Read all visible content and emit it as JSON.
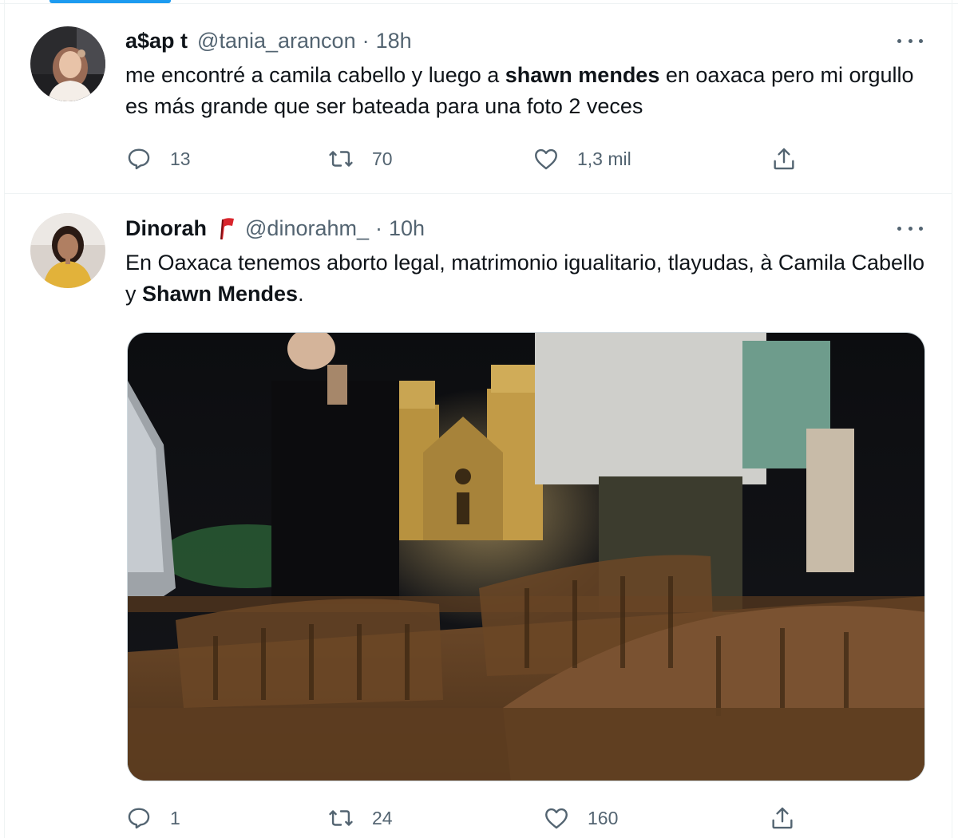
{
  "tweets": [
    {
      "name": "a$ap t",
      "handle": "@tania_arancon",
      "separator": "·",
      "time": "18h",
      "text_parts": [
        {
          "t": "me encontré a camila cabello y luego a ",
          "b": false
        },
        {
          "t": "shawn mendes",
          "b": true
        },
        {
          "t": " en oaxaca pero mi orgullo es más grande que ser bateada para una foto 2 veces",
          "b": false
        }
      ],
      "stats": {
        "replies": "13",
        "retweets": "70",
        "likes": "1,3 mil"
      },
      "has_media": false
    },
    {
      "name": "Dinorah",
      "name_badge_icon": "red-flag-icon",
      "handle": "@dinorahm_",
      "separator": "·",
      "time": "10h",
      "text_parts": [
        {
          "t": "En Oaxaca tenemos aborto legal, matrimonio igualitario, tlayudas, à Camila Cabello y ",
          "b": false
        },
        {
          "t": "Shawn Mendes",
          "b": true
        },
        {
          "t": ".",
          "b": false
        }
      ],
      "stats": {
        "replies": "1",
        "retweets": "24",
        "likes": "160"
      },
      "has_media": true
    }
  ],
  "icons": {
    "reply": "reply-icon",
    "retweet": "retweet-icon",
    "like": "heart-icon",
    "share": "share-icon",
    "more": "more-options-icon"
  },
  "colors": {
    "accent": "#1d9bf0",
    "text_primary": "#0f1419",
    "text_secondary": "#536471",
    "divider": "#eff3f4",
    "flag_red": "#d9252c"
  }
}
